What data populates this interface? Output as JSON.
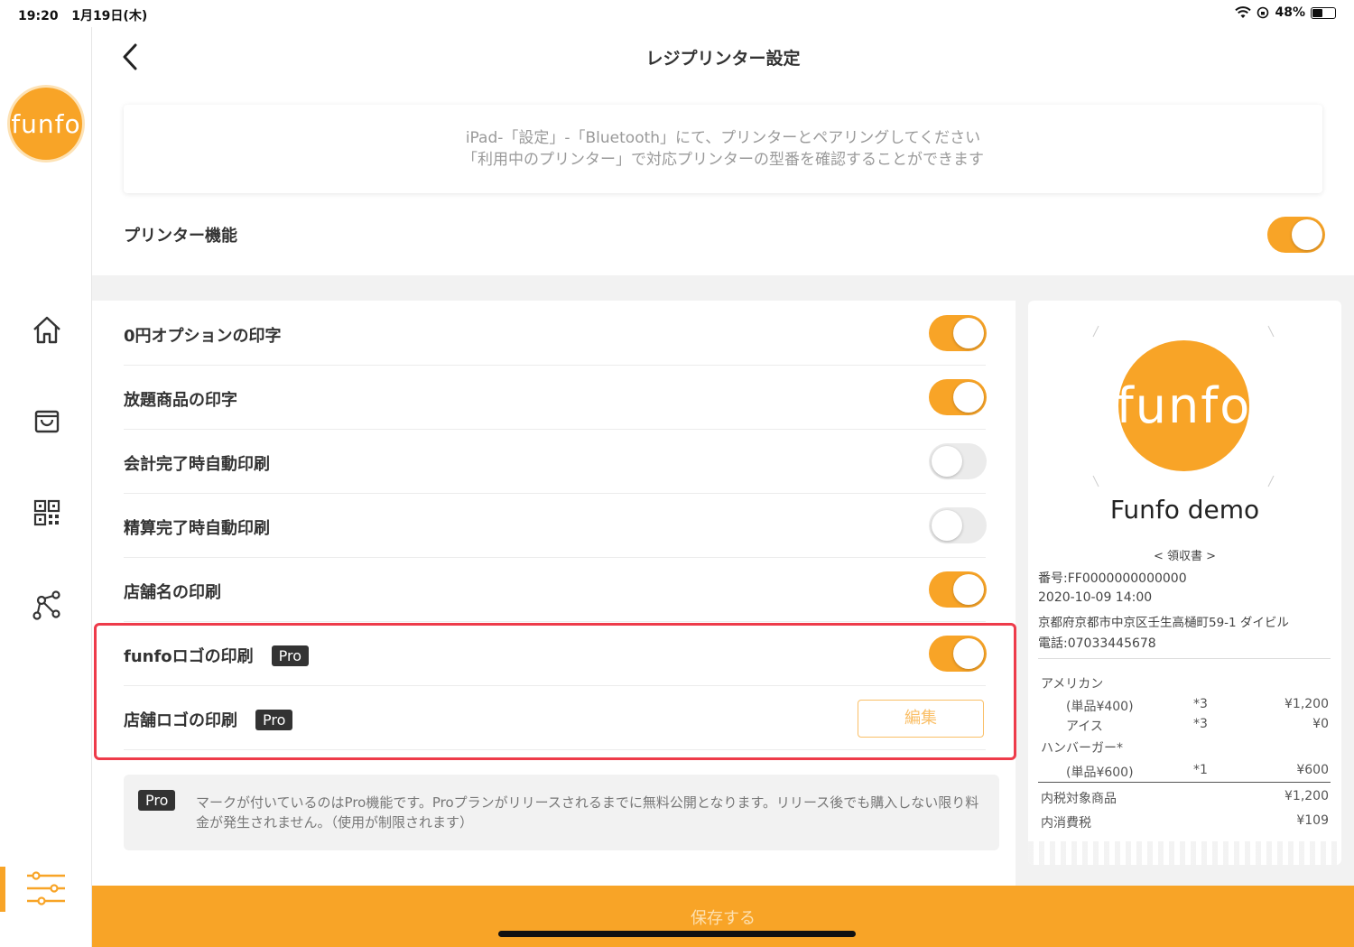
{
  "status_bar": {
    "time": "19:20",
    "date": "1月19日(木)",
    "battery": "48%",
    "battery_level": 0.48
  },
  "sidebar": {
    "logo": "funfo",
    "items": [
      {
        "icon": "home-icon"
      },
      {
        "icon": "shopping-bag-icon"
      },
      {
        "icon": "qr-code-icon"
      },
      {
        "icon": "network-icon"
      },
      {
        "icon": "sliders-icon",
        "active": true
      }
    ]
  },
  "header": {
    "title": "レジプリンター設定"
  },
  "info": {
    "line1": "iPad-「設定」-「Bluetooth」にて、プリンターとペアリングしてください",
    "line2": "「利用中のプリンター」で対応プリンターの型番を確認することができます"
  },
  "printer_function": {
    "label": "プリンター機能",
    "on": true
  },
  "settings": [
    {
      "label": "0円オプションの印字",
      "on": true
    },
    {
      "label": "放題商品の印字",
      "on": true
    },
    {
      "label": "会計完了時自動印刷",
      "on": false
    },
    {
      "label": "精算完了時自動印刷",
      "on": false
    },
    {
      "label": "店舗名の印刷",
      "on": true
    },
    {
      "label": "funfoロゴの印刷",
      "badge": "Pro",
      "on": true
    },
    {
      "label": "店舗ロゴの印刷",
      "badge": "Pro",
      "button": "編集"
    }
  ],
  "pro_note": {
    "badge": "Pro",
    "text": "マークが付いているのはPro機能です。Proプランがリリースされるまでに無料公開となります。リリース後でも購入しない限り料金が発生されません。（使用が制限されます）"
  },
  "receipt": {
    "logo": "funfo",
    "shop_name": "Funfo demo",
    "heading": "< 領収書 >",
    "number": "番号:FF0000000000000",
    "datetime": "2020-10-09 14:00",
    "address": "京都府京都市中京区壬生高樋町59-1 ダイビル",
    "phone": "電話:07033445678",
    "items": [
      {
        "name": "アメリカン"
      },
      {
        "name": "(単品¥400)",
        "qty": "*3",
        "price": "¥1,200"
      },
      {
        "name": "アイス",
        "qty": "*3",
        "price": "¥0"
      },
      {
        "name": "ハンバーガー*"
      },
      {
        "name": "(単品¥600)",
        "qty": "*1",
        "price": "¥600"
      }
    ],
    "totals": [
      {
        "label": "内税対象商品",
        "value": "¥1,200"
      },
      {
        "label": "内消費税",
        "value": "¥109"
      }
    ]
  },
  "save_button": "保存する"
}
